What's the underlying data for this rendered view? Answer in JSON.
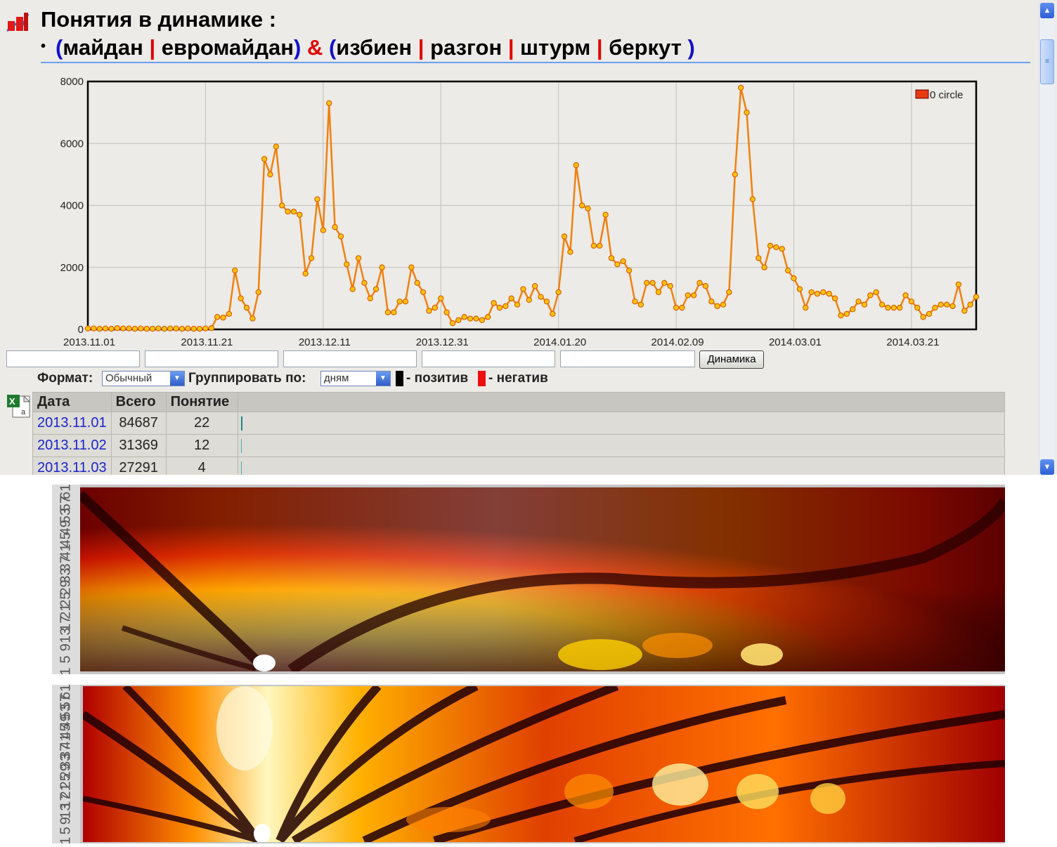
{
  "page": {
    "title": "Понятия в динамике :",
    "query": {
      "bullet": "•",
      "open1": "(",
      "terms1": [
        "майдан",
        "евромайдан"
      ],
      "close1": ")",
      "amp": "&",
      "open2": "(",
      "terms2": [
        "избиен",
        "разгон",
        "штурм",
        "беркут"
      ],
      "close2": ")",
      "sep": "|"
    }
  },
  "chart_data": {
    "type": "line",
    "title": "",
    "xlabel": "",
    "ylabel": "",
    "ylim": [
      0,
      8000
    ],
    "yticks": [
      0,
      2000,
      4000,
      6000,
      8000
    ],
    "xtick_labels": [
      "2013.11.01",
      "2013.11.21",
      "2013.12.11",
      "2013.12.31",
      "2014.01.20",
      "2014.02.09",
      "2014.03.01",
      "2014.03.21"
    ],
    "grid": true,
    "legend": {
      "position": "top-right",
      "label": "0 circle",
      "color": "#e83a10"
    },
    "line_color": "#f08010",
    "marker_fill": "#f6c410",
    "series": [
      {
        "name": "0 circle",
        "values": [
          30,
          30,
          20,
          30,
          20,
          40,
          30,
          30,
          20,
          30,
          20,
          20,
          30,
          20,
          30,
          30,
          20,
          30,
          20,
          20,
          30,
          40,
          400,
          380,
          500,
          1900,
          1000,
          700,
          350,
          1200,
          5500,
          5000,
          5900,
          4000,
          3800,
          3800,
          3700,
          1800,
          2300,
          4200,
          3200,
          7300,
          3300,
          3000,
          2100,
          1300,
          2300,
          1500,
          1000,
          1300,
          2000,
          550,
          550,
          900,
          900,
          2000,
          1500,
          1200,
          600,
          700,
          1000,
          550,
          200,
          300,
          400,
          350,
          350,
          300,
          400,
          850,
          700,
          750,
          1000,
          800,
          1300,
          950,
          1400,
          1050,
          900,
          500,
          1200,
          3000,
          2500,
          5300,
          4000,
          3900,
          2700,
          2700,
          3700,
          2300,
          2100,
          2200,
          1900,
          900,
          800,
          1500,
          1500,
          1200,
          1500,
          1400,
          700,
          700,
          1100,
          1100,
          1500,
          1400,
          900,
          750,
          800,
          1200,
          5000,
          7800,
          7000,
          4200,
          2300,
          2000,
          2700,
          2650,
          2600,
          1900,
          1650,
          1300,
          700,
          1200,
          1150,
          1200,
          1150,
          1000,
          450,
          500,
          650,
          900,
          800,
          1100,
          1200,
          800,
          700,
          700,
          700,
          1100,
          900,
          700,
          400,
          500,
          700,
          800,
          800,
          750,
          1450,
          600,
          800,
          1050
        ]
      }
    ]
  },
  "controls": {
    "format_label": "Формат:",
    "format_value": "Обычный",
    "group_label": "Группировать по:",
    "group_value": "дням",
    "positive_label": "- позитив",
    "negative_label": "- негатив",
    "positive_color": "#000000",
    "negative_color": "#ee1010",
    "dynamics_button": "Динамика"
  },
  "table": {
    "headers": [
      "Дата",
      "Всего",
      "Понятие"
    ],
    "rows": [
      {
        "date": "2013.11.01",
        "total": "84687",
        "concept": "22"
      },
      {
        "date": "2013.11.02",
        "total": "31369",
        "concept": "12"
      },
      {
        "date": "2013.11.03",
        "total": "27291",
        "concept": "4"
      }
    ]
  },
  "heatmaps": {
    "y_labels": [
      "61",
      "57",
      "53",
      "49",
      "45",
      "41",
      "37",
      "33",
      "29",
      "25",
      "21",
      "17",
      "13",
      "9",
      "5",
      "1"
    ]
  },
  "colors": {
    "link": "#1a24cc",
    "query_paren": "#1111cc",
    "query_sep": "#e00000"
  }
}
